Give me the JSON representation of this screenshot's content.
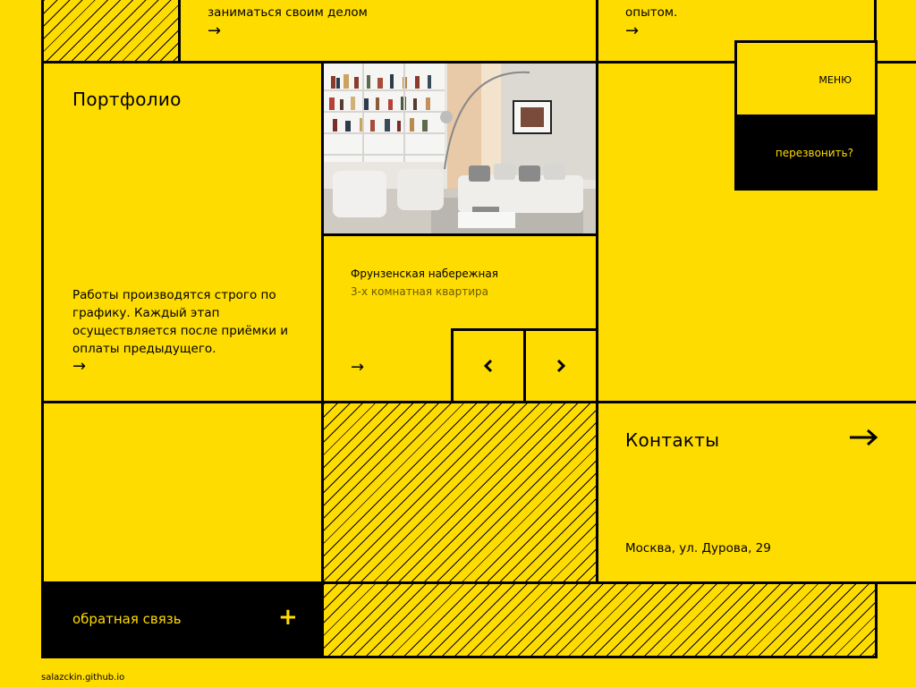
{
  "top": {
    "left_text": "заниматься своим делом",
    "right_text": "опытом."
  },
  "menu": {
    "menu_label": "МЕНЮ",
    "callback_label": "перезвонить?"
  },
  "portfolio": {
    "title": "Портфолио",
    "description_lines": [
      "Работы производятся строго по",
      "графику. Каждый этап",
      "осуществляется после приёмки и",
      "оплаты предыдущего."
    ]
  },
  "project": {
    "name": "Фрунзенская набережная",
    "subtitle": "3-х комнатная квартира"
  },
  "contacts": {
    "title": "Контакты",
    "address": "Москва, ул. Дурова, 29"
  },
  "feedback": {
    "label": "обратная связь",
    "plus": "+"
  },
  "footer": {
    "site": "salazckin.github.io"
  },
  "arrow": "→",
  "colors": {
    "background": "#FFDC00",
    "ink": "#000000"
  }
}
